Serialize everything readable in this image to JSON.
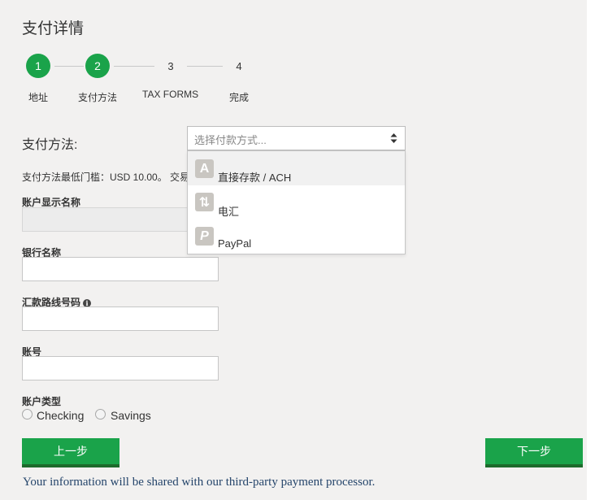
{
  "page": {
    "title": "支付详情"
  },
  "steps": [
    {
      "number": "1",
      "label": "地址",
      "state": "complete"
    },
    {
      "number": "2",
      "label": "支付方法",
      "state": "current"
    },
    {
      "number": "3",
      "label": "TAX FORMS",
      "state": "upcoming"
    },
    {
      "number": "4",
      "label": "完成",
      "state": "upcoming"
    }
  ],
  "payment_method": {
    "label": "支付方法:",
    "placeholder": "选择付款方式...",
    "options": [
      {
        "icon": "letter-a-icon",
        "glyph": "A",
        "label": "直接存款 / ACH"
      },
      {
        "icon": "transfer-arrows-icon",
        "glyph": "⇅",
        "label": "电汇"
      },
      {
        "icon": "paypal-icon",
        "glyph": "P",
        "label": "PayPal"
      }
    ]
  },
  "minimum_note": "支付方法最低门槛：USD 10.00。 交易",
  "fields": {
    "account_display_name": {
      "label": "账户显示名称",
      "value": ""
    },
    "bank_name": {
      "label": "银行名称",
      "value": ""
    },
    "routing_number": {
      "label": "汇款路线号码",
      "info": "i",
      "value": ""
    },
    "account_number": {
      "label": "账号",
      "value": ""
    },
    "account_type": {
      "label": "账户类型",
      "options": [
        "Checking",
        "Savings"
      ]
    }
  },
  "buttons": {
    "prev": "上一步",
    "next": "下一步"
  },
  "footer_note": "Your information will be shared with our third-party payment processor.",
  "colors": {
    "accent": "#1aa34a",
    "panel_bg": "#f2f1f0",
    "footer_text": "#25456b"
  }
}
